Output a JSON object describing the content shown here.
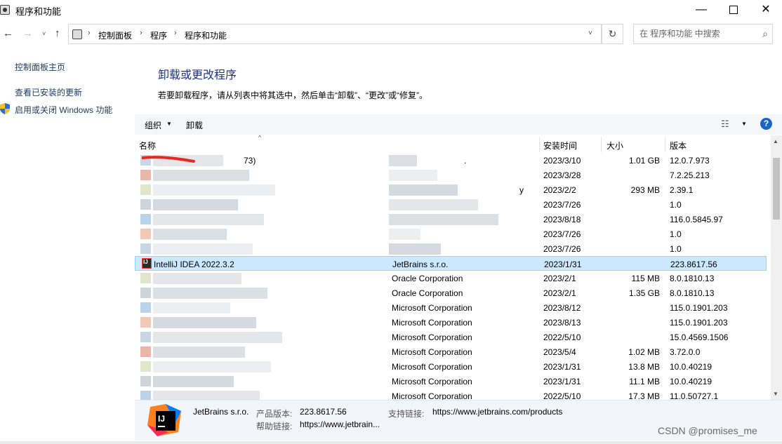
{
  "window": {
    "title": "程序和功能",
    "min_glyph": "—",
    "close_glyph": "✕"
  },
  "nav": {
    "back": "←",
    "forward": "→",
    "recent": "˅",
    "up": "↑",
    "breadcrumb": [
      "控制面板",
      "程序",
      "程序和功能"
    ],
    "crumb_sep": "›",
    "dropdown": "˅",
    "refresh": "↻"
  },
  "search": {
    "placeholder": "在 程序和功能 中搜索",
    "icon": "⌕"
  },
  "sidebar": {
    "items": [
      {
        "label": "控制面板主页"
      },
      {
        "label": "查看已安装的更新"
      },
      {
        "label": "启用或关闭 Windows 功能"
      }
    ]
  },
  "main": {
    "title": "卸载或更改程序",
    "description": "若要卸载程序，请从列表中将其选中，然后单击“卸载”、“更改”或“修复”。"
  },
  "toolbar": {
    "organize": "组织",
    "organize_arrow": "▼",
    "uninstall": "卸载",
    "view_icon": "☷",
    "view_arrow": "▼",
    "help": "?"
  },
  "columns": {
    "name": "名称",
    "sort_arrow": "^",
    "date": "安装时间",
    "size": "大小",
    "version": "版本"
  },
  "rows": [
    {
      "name": "73)",
      "publisher": ".",
      "date": "2023/3/10",
      "size": "1.01 GB",
      "version": "12.0.7.973"
    },
    {
      "name": "",
      "publisher": "",
      "date": "2023/3/28",
      "size": "",
      "version": "7.2.25.213"
    },
    {
      "name": "",
      "publisher": "y",
      "date": "2023/2/2",
      "size": "293 MB",
      "version": "2.39.1"
    },
    {
      "name": "",
      "publisher": "",
      "date": "2023/7/26",
      "size": "",
      "version": "1.0"
    },
    {
      "name": "",
      "publisher": "",
      "date": "2023/8/18",
      "size": "",
      "version": "116.0.5845.97"
    },
    {
      "name": "",
      "publisher": "",
      "date": "2023/7/26",
      "size": "",
      "version": "1.0"
    },
    {
      "name": "",
      "publisher": "",
      "date": "2023/7/26",
      "size": "",
      "version": "1.0"
    },
    {
      "name": "IntelliJ IDEA 2022.3.2",
      "publisher": "JetBrains s.r.o.",
      "date": "2023/1/31",
      "size": "",
      "version": "223.8617.56",
      "selected": true
    },
    {
      "name": "",
      "publisher": "Oracle Corporation",
      "date": "2023/2/1",
      "size": "115 MB",
      "version": "8.0.1810.13"
    },
    {
      "name": "",
      "publisher": "Oracle Corporation",
      "date": "2023/2/1",
      "size": "1.35 GB",
      "version": "8.0.1810.13"
    },
    {
      "name": "",
      "publisher": "Microsoft Corporation",
      "date": "2023/8/12",
      "size": "",
      "version": "115.0.1901.203"
    },
    {
      "name": "",
      "publisher": "Microsoft Corporation",
      "date": "2023/8/13",
      "size": "",
      "version": "115.0.1901.203"
    },
    {
      "name": "",
      "publisher": "Microsoft Corporation",
      "date": "2022/5/10",
      "size": "",
      "version": "15.0.4569.1506"
    },
    {
      "name": "",
      "publisher": "Microsoft Corporation",
      "date": "2023/5/4",
      "size": "1.02 MB",
      "version": "3.72.0.0"
    },
    {
      "name": "",
      "publisher": "Microsoft Corporation",
      "date": "2023/1/31",
      "size": "13.8 MB",
      "version": "10.0.40219"
    },
    {
      "name": "",
      "publisher": "Microsoft Corporation",
      "date": "2023/1/31",
      "size": "11.1 MB",
      "version": "10.0.40219"
    },
    {
      "name": "",
      "publisher": "Microsoft Corporation",
      "date": "2022/5/10",
      "size": "17.3 MB",
      "version": "11.0.50727.1"
    }
  ],
  "scrollbar": {
    "up": "▲",
    "down": "▼"
  },
  "details": {
    "publisher": "JetBrains s.r.o.",
    "product_version_label": "产品版本:",
    "product_version": "223.8617.56",
    "support_link_label": "支持链接:",
    "support_link": "https://www.jetbrains.com/products",
    "help_link_label": "帮助链接:",
    "help_link": "https://www.jetbrain..."
  },
  "watermark": "CSDN @promises_me",
  "colors": {
    "title_blue": "#1e3287",
    "selection": "#cce8ff",
    "selection_border": "#99d1ff",
    "toolbar_bg": "#f5f6f7",
    "details_bg": "#f2f5fa",
    "help_blue": "#1a64c8"
  }
}
